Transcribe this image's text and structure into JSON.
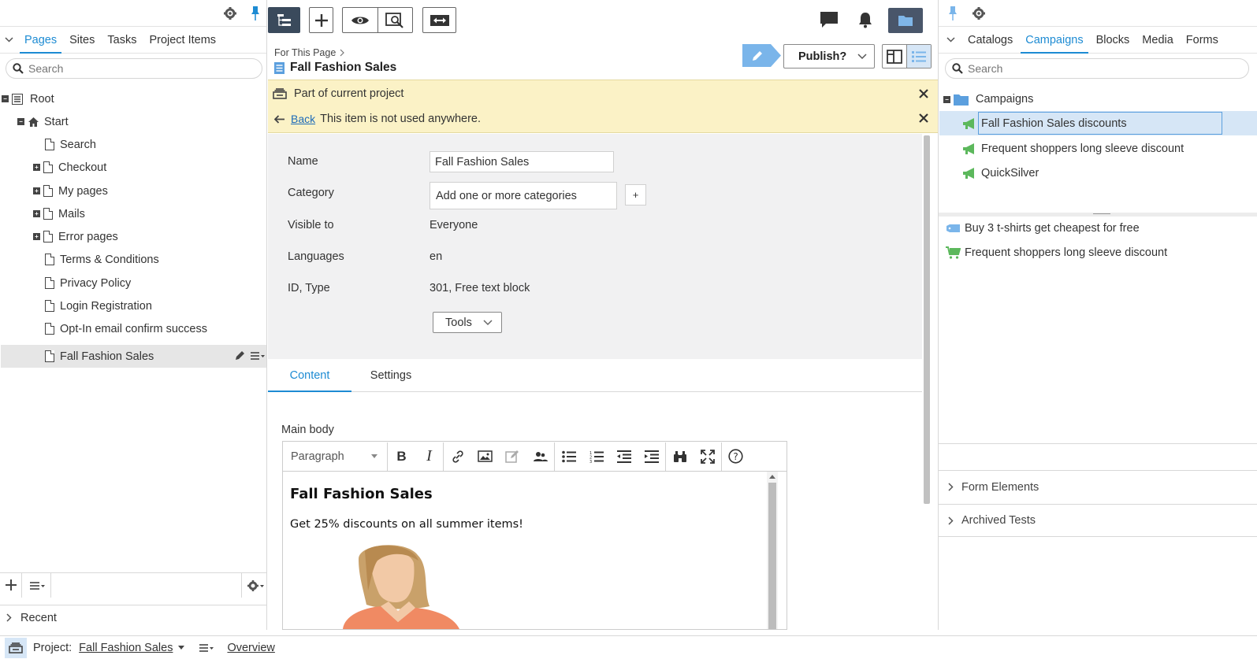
{
  "left_pane": {
    "tabs": [
      {
        "label": "Pages",
        "active": true
      },
      {
        "label": "Sites",
        "active": false
      },
      {
        "label": "Tasks",
        "active": false
      },
      {
        "label": "Project Items",
        "active": false
      }
    ],
    "search_placeholder": "Search",
    "tree": [
      {
        "label": "Root",
        "expander": "minus",
        "icon": "list-icon"
      },
      {
        "label": "Start",
        "expander": "minus",
        "icon": "home-icon"
      },
      {
        "label": "Search",
        "expander": "",
        "icon": "page-icon"
      },
      {
        "label": "Checkout",
        "expander": "plus",
        "icon": "page-icon"
      },
      {
        "label": "My pages",
        "expander": "plus",
        "icon": "page-icon"
      },
      {
        "label": "Mails",
        "expander": "plus",
        "icon": "page-icon"
      },
      {
        "label": "Error pages",
        "expander": "plus",
        "icon": "page-icon"
      },
      {
        "label": "Terms & Conditions",
        "expander": "",
        "icon": "page-icon"
      },
      {
        "label": "Privacy Policy",
        "expander": "",
        "icon": "page-icon"
      },
      {
        "label": "Login Registration",
        "expander": "",
        "icon": "page-icon"
      },
      {
        "label": "Opt-In email confirm success",
        "expander": "",
        "icon": "page-icon"
      },
      {
        "label": "Fall Fashion Sales",
        "expander": "",
        "icon": "page-icon",
        "selected": true
      }
    ],
    "recent_label": "Recent"
  },
  "center": {
    "breadcrumb": "For This Page",
    "page_title": "Fall Fashion Sales",
    "publish_label": "Publish?",
    "notices": {
      "project_text": "Part of current project",
      "back_label": "Back",
      "usage_text": "This item is not used anywhere."
    },
    "properties": {
      "name_label": "Name",
      "name_value": "Fall Fashion Sales",
      "category_label": "Category",
      "category_placeholder": "Add one or more categories",
      "category_add": "+",
      "visible_label": "Visible to",
      "visible_value": "Everyone",
      "languages_label": "Languages",
      "languages_value": "en",
      "id_label": "ID, Type",
      "id_value": "301, Free text block",
      "tools_label": "Tools"
    },
    "content_tabs": [
      {
        "label": "Content",
        "active": true
      },
      {
        "label": "Settings",
        "active": false
      }
    ],
    "editor": {
      "field_label": "Main body",
      "format_select": "Paragraph",
      "heading": "Fall Fashion Sales",
      "body": "Get 25% discounts on all summer items!"
    }
  },
  "right_pane": {
    "tabs": [
      {
        "label": "Catalogs",
        "active": false
      },
      {
        "label": "Campaigns",
        "active": true
      },
      {
        "label": "Blocks",
        "active": false
      },
      {
        "label": "Media",
        "active": false
      },
      {
        "label": "Forms",
        "active": false
      }
    ],
    "search_placeholder": "Search",
    "folder": "Campaigns",
    "campaigns": [
      {
        "label": "Fall Fashion Sales discounts",
        "selected": true
      },
      {
        "label": "Frequent shoppers long sleeve discount",
        "selected": false
      },
      {
        "label": "QuickSilver",
        "selected": false
      }
    ],
    "discounts": [
      {
        "label": "Buy 3 t-shirts get cheapest for free",
        "icon": "tag-icon"
      },
      {
        "label": "Frequent shoppers long sleeve discount",
        "icon": "cart-icon"
      }
    ],
    "accordions": [
      "Form Elements",
      "Archived Tests"
    ]
  },
  "footer": {
    "project_label": "Project:",
    "project_value": "Fall Fashion Sales",
    "overview_label": "Overview"
  },
  "colors": {
    "accent": "#1d8bd3",
    "notice_bg": "#fbf2c6",
    "selected_bg": "#d6e6f6",
    "campaign_green": "#5cb85c",
    "toolbar_dark": "#3a4a5c"
  }
}
